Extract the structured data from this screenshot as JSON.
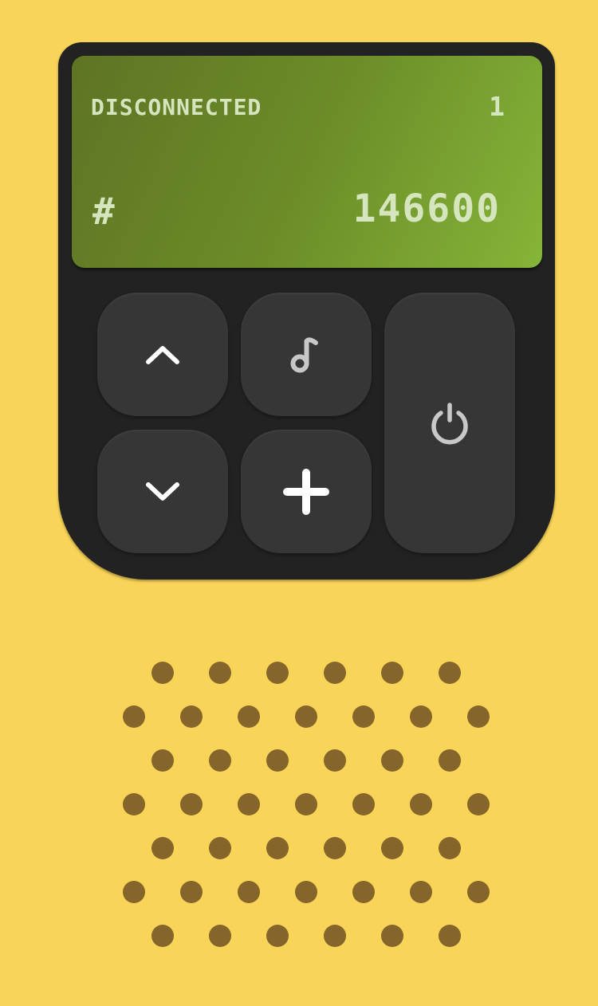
{
  "display": {
    "status": "DISCONNECTED",
    "channel": "1",
    "hash_symbol": "#",
    "frequency": "146600"
  },
  "controls": {
    "up": {
      "icon": "chevron-up-icon"
    },
    "down": {
      "icon": "chevron-down-icon"
    },
    "music": {
      "icon": "music-note-icon"
    },
    "add": {
      "icon": "plus-icon"
    },
    "power": {
      "icon": "power-icon"
    }
  },
  "colors": {
    "background": "#F8D458",
    "device_body": "#222222",
    "button": "#363636",
    "screen_start": "#5E7424",
    "screen_end": "#85B538",
    "screen_text": "#D5E6BF",
    "speaker_hole": "#85652A"
  },
  "speaker": {
    "rows": [
      6,
      7,
      6,
      7,
      6,
      7,
      6
    ]
  }
}
